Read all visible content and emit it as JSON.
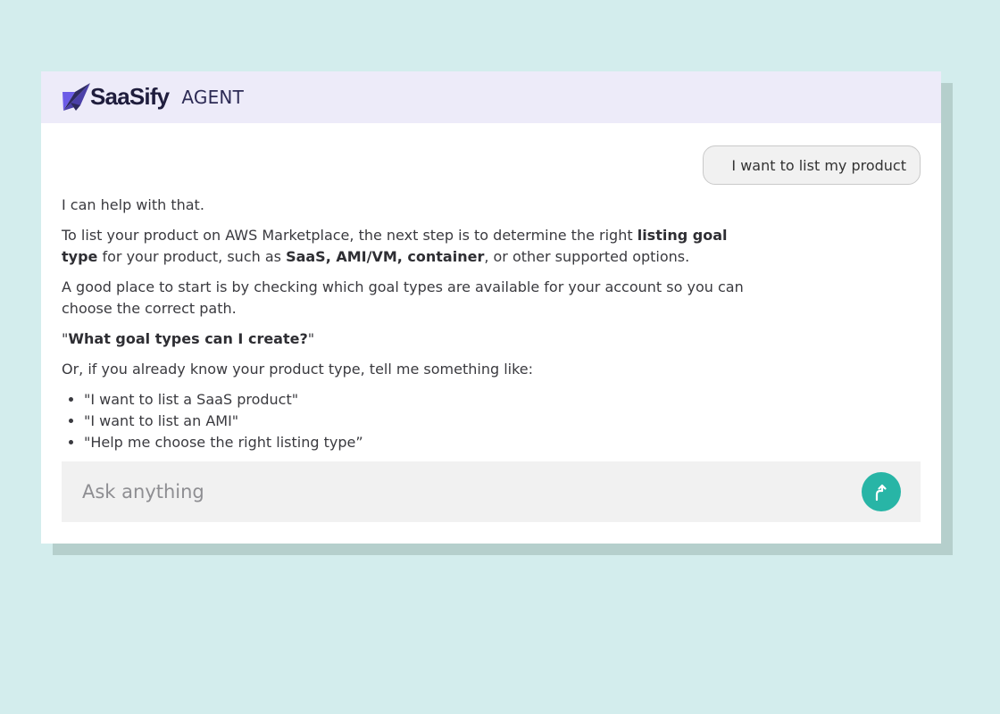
{
  "app": {
    "brand": "SaaSify",
    "product": "AGENT",
    "accent_color": "#28b5a6",
    "header_bg": "#edebf9"
  },
  "conversation": {
    "user_message": "I want to list my product",
    "assistant": {
      "intro": "I can help with that.",
      "p1_prefix": "To list your product on AWS Marketplace, the next step is to determine the right ",
      "p1_bold1": "listing goal type",
      "p1_middle": " for your product, such as ",
      "p1_bold2": "SaaS, AMI/VM, container",
      "p1_suffix": ", or other supported options.",
      "p2": "A good place to start is by checking which goal types are available for your account so you can choose the correct path.",
      "quote_open": "\"",
      "quote_bold": "What goal types can I create?",
      "quote_close": "\"",
      "p4": "Or, if you already know your product type, tell me something like:",
      "suggestions": [
        "\"I want to list a SaaS product\"",
        "\"I want to list an AMI\"",
        "\"Help me choose the right listing type”"
      ]
    }
  },
  "composer": {
    "placeholder": "Ask anything",
    "value": "",
    "send_icon": "arrow-up-right-icon"
  }
}
